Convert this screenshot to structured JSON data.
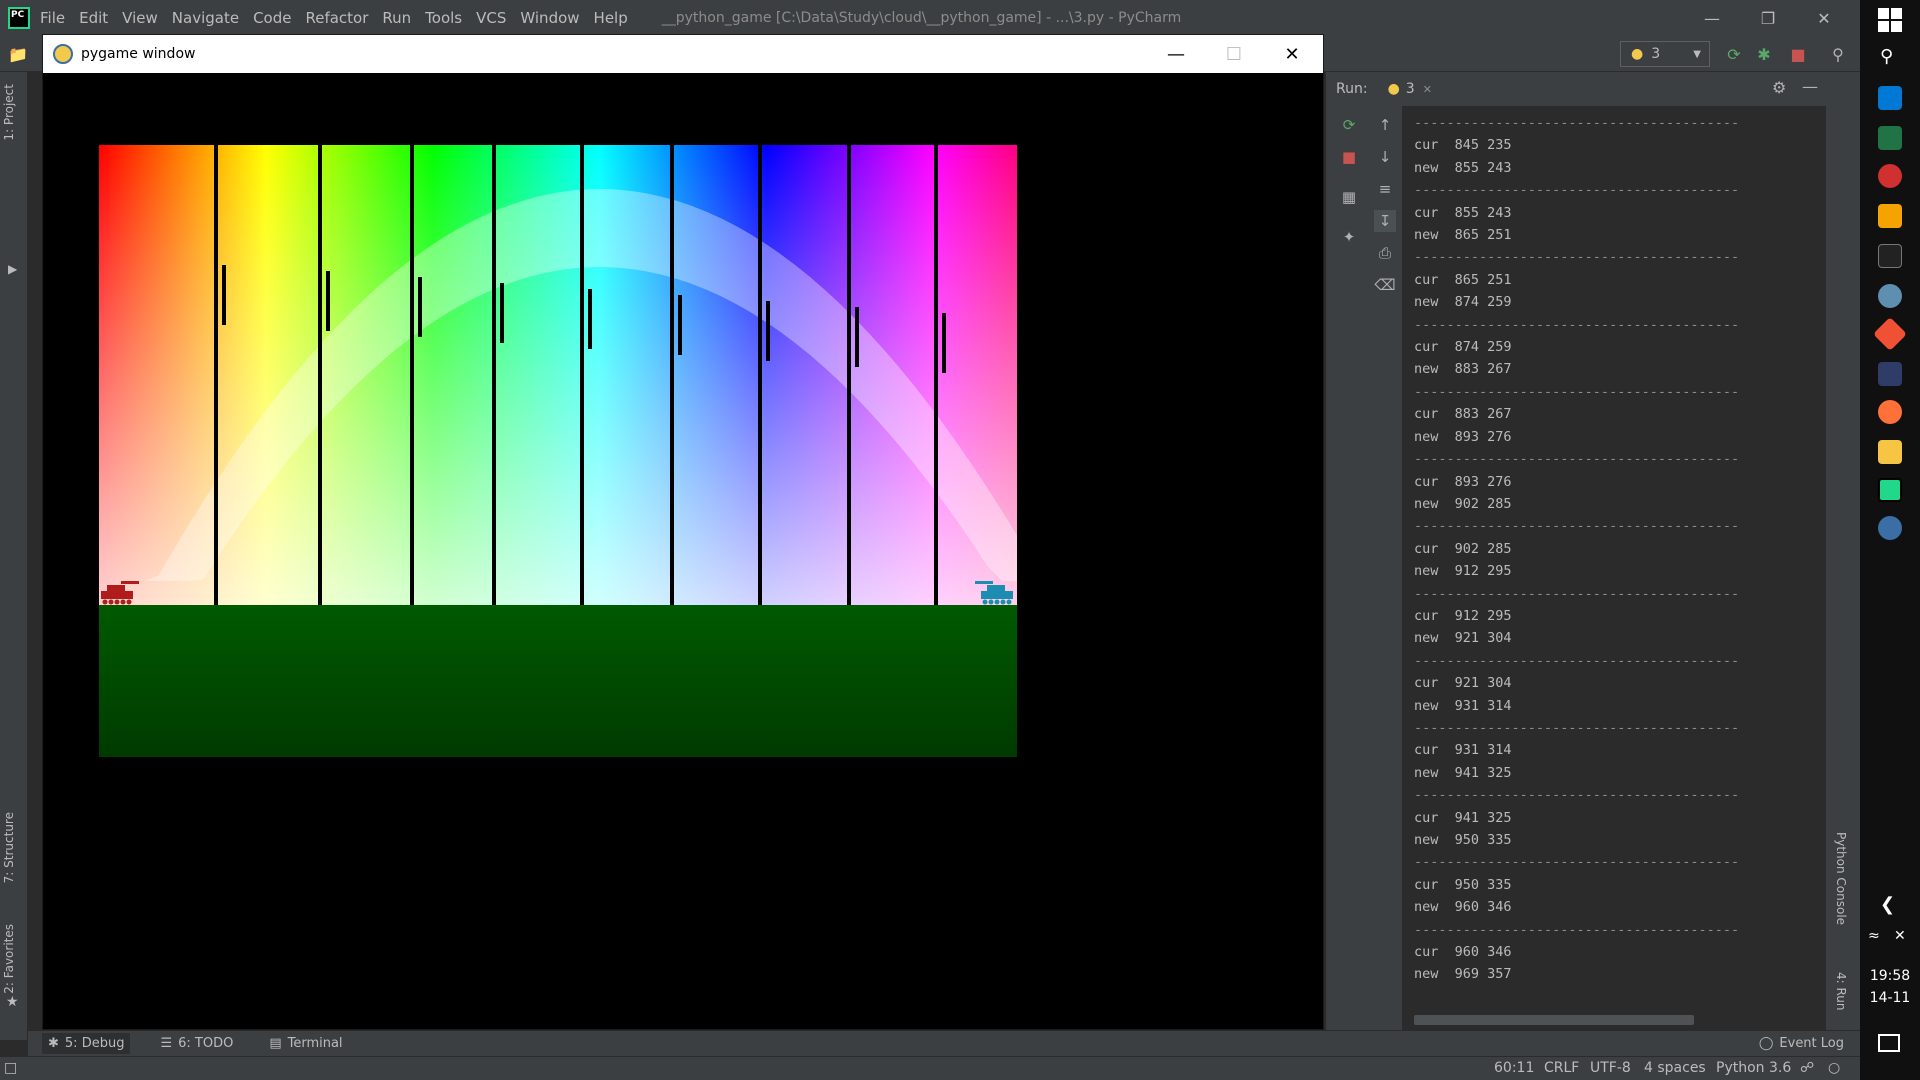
{
  "ide": {
    "menu": [
      "File",
      "Edit",
      "View",
      "Navigate",
      "Code",
      "Refactor",
      "Run",
      "Tools",
      "VCS",
      "Window",
      "Help"
    ],
    "title": "__python_game [C:\\Data\\Study\\cloud\\__python_game] - ...\\3.py - PyCharm",
    "run_config": "3"
  },
  "left_strip": {
    "project_tab": "1: Project",
    "structure_tab": "7: Structure",
    "favorites_tab": "2: Favorites"
  },
  "pygame_window": {
    "title": "pygame window",
    "colors": {
      "sky_hues": [
        "#ff0000",
        "#ff8000",
        "#ffff00",
        "#80ff00",
        "#00ff00",
        "#00ff80",
        "#00ffff",
        "#0080ff",
        "#0000ff",
        "#8000ff",
        "#ff00ff",
        "#ff0080"
      ],
      "ground_top": "#005a00",
      "ground_bottom": "#003a00",
      "tank_left": "#b01b1b",
      "tank_right": "#1b8db0"
    }
  },
  "run_panel": {
    "label": "Run:",
    "tab": "3",
    "console": [
      {
        "cur": "cur  845 235",
        "new": "new  855 243"
      },
      {
        "cur": "cur  855 243",
        "new": "new  865 251"
      },
      {
        "cur": "cur  865 251",
        "new": "new  874 259"
      },
      {
        "cur": "cur  874 259",
        "new": "new  883 267"
      },
      {
        "cur": "cur  883 267",
        "new": "new  893 276"
      },
      {
        "cur": "cur  893 276",
        "new": "new  902 285"
      },
      {
        "cur": "cur  902 285",
        "new": "new  912 295"
      },
      {
        "cur": "cur  912 295",
        "new": "new  921 304"
      },
      {
        "cur": "cur  921 304",
        "new": "new  931 314"
      },
      {
        "cur": "cur  931 314",
        "new": "new  941 325"
      },
      {
        "cur": "cur  941 325",
        "new": "new  950 335"
      },
      {
        "cur": "cur  950 335",
        "new": "new  960 346"
      },
      {
        "cur": "cur  960 346",
        "new": "new  969 357"
      }
    ],
    "separator": "----------------------------------------"
  },
  "right_strip": {
    "python_console": "Python Console",
    "run_tab": "4: Run"
  },
  "bottom_tabs": [
    "5: Debug",
    "6: TODO",
    "Terminal"
  ],
  "event_log": "Event Log",
  "status": {
    "position": "60:11",
    "line_sep": "CRLF",
    "encoding": "UTF-8",
    "indent": "4 spaces",
    "interpreter": "Python 3.6"
  },
  "clock": {
    "time": "19:58",
    "date": "14-11"
  }
}
